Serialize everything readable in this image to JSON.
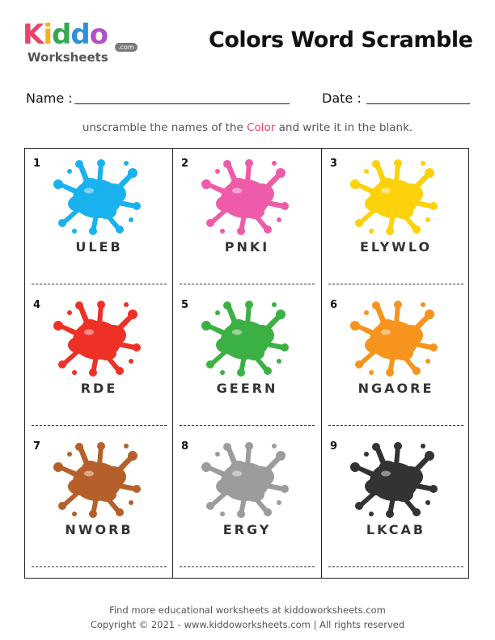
{
  "logo": {
    "letters": [
      {
        "ch": "K",
        "color": "#e8436a"
      },
      {
        "ch": "i",
        "color": "#f7b21b"
      },
      {
        "ch": "d",
        "color": "#33a852"
      },
      {
        "ch": "d",
        "color": "#2f8fd8"
      },
      {
        "ch": "o",
        "color": "#b04fc6"
      }
    ],
    "sub": "Worksheets",
    "com": ".com"
  },
  "title": "Colors Word Scramble",
  "name_label": "Name :",
  "date_label": "Date :",
  "instruction": {
    "before": "unscramble the names of the ",
    "highlight": "Color",
    "after": " and write it in the blank."
  },
  "cells": [
    {
      "num": "1",
      "word": "ULEB",
      "color": "#19b2ee"
    },
    {
      "num": "2",
      "word": "PNKI",
      "color": "#ee5ba9"
    },
    {
      "num": "3",
      "word": "ELYWLO",
      "color": "#fdd20a"
    },
    {
      "num": "4",
      "word": "RDE",
      "color": "#ee3127"
    },
    {
      "num": "5",
      "word": "GEERN",
      "color": "#3bb143"
    },
    {
      "num": "6",
      "word": "NGAORE",
      "color": "#f7941d"
    },
    {
      "num": "7",
      "word": "NWORB",
      "color": "#b5602a"
    },
    {
      "num": "8",
      "word": "ERGY",
      "color": "#9c9c9c"
    },
    {
      "num": "9",
      "word": "LKCAB",
      "color": "#333333"
    }
  ],
  "footer": {
    "line1": "Find more educational worksheets at kiddoworksheets.com",
    "line2": "Copyright © 2021 - www.kiddoworksheets.com  |  All rights reserved"
  }
}
